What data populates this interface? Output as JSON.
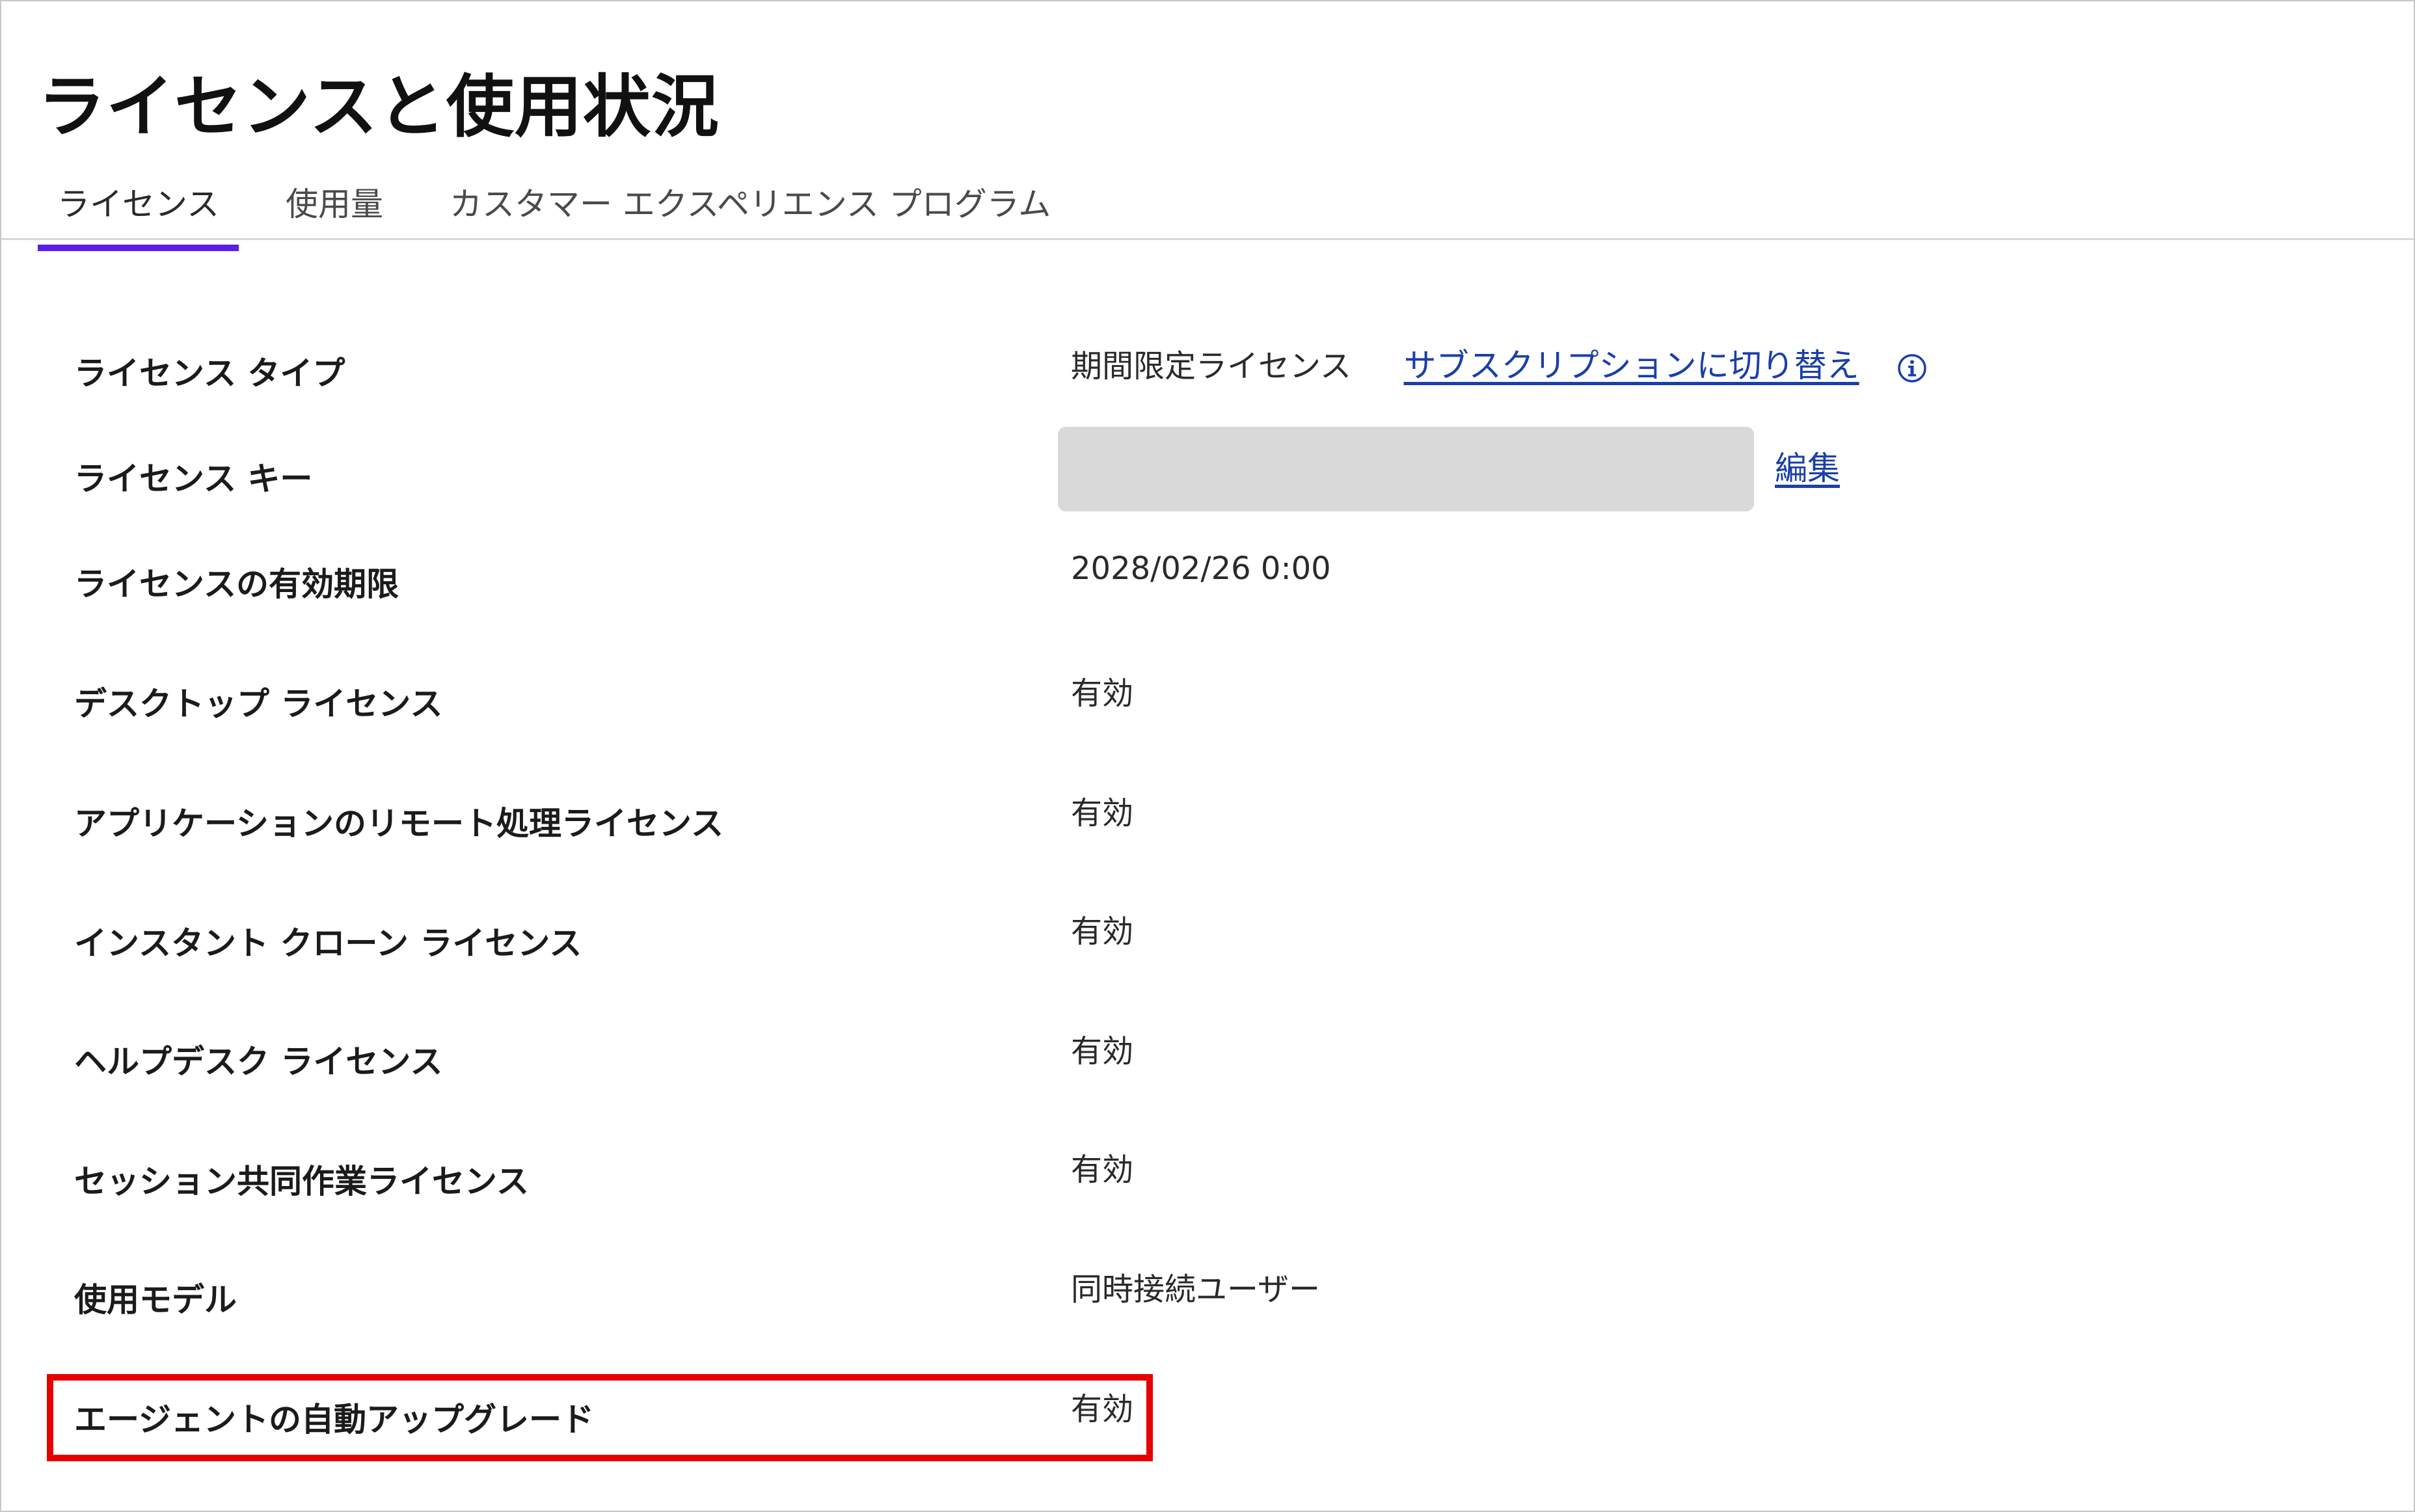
{
  "page": {
    "title": "ライセンスと使用状況"
  },
  "tabs": [
    {
      "label": "ライセンス",
      "active": true
    },
    {
      "label": "使用量",
      "active": false
    },
    {
      "label": "カスタマー エクスペリエンス プログラム",
      "active": false
    }
  ],
  "rows": {
    "license_type": {
      "label": "ライセンス タイプ",
      "value": "期間限定ライセンス",
      "link": "サブスクリプションに切り替え",
      "icon": "info-icon"
    },
    "license_key": {
      "label": "ライセンス キー",
      "value": "",
      "link": "編集"
    },
    "license_expiry": {
      "label": "ライセンスの有効期限",
      "value": "2028/02/26 0:00"
    },
    "desktop_license": {
      "label": "デスクトップ ライセンス",
      "value": "有効"
    },
    "app_remote_license": {
      "label": "アプリケーションのリモート処理ライセンス",
      "value": "有効"
    },
    "instant_clone_license": {
      "label": "インスタント クローン ライセンス",
      "value": "有効"
    },
    "helpdesk_license": {
      "label": "ヘルプデスク ライセンス",
      "value": "有効"
    },
    "session_collab_license": {
      "label": "セッション共同作業ライセンス",
      "value": "有効"
    },
    "usage_model": {
      "label": "使用モデル",
      "value": "同時接続ユーザー"
    },
    "agent_auto_upgrade": {
      "label": "エージェントの自動アップグレード",
      "value": "有効",
      "highlighted": true
    }
  },
  "colors": {
    "tab_indicator": "#5b1ee8",
    "link": "#1a3fa8",
    "highlight_border": "#e60000",
    "key_box": "#d9d9d9"
  }
}
